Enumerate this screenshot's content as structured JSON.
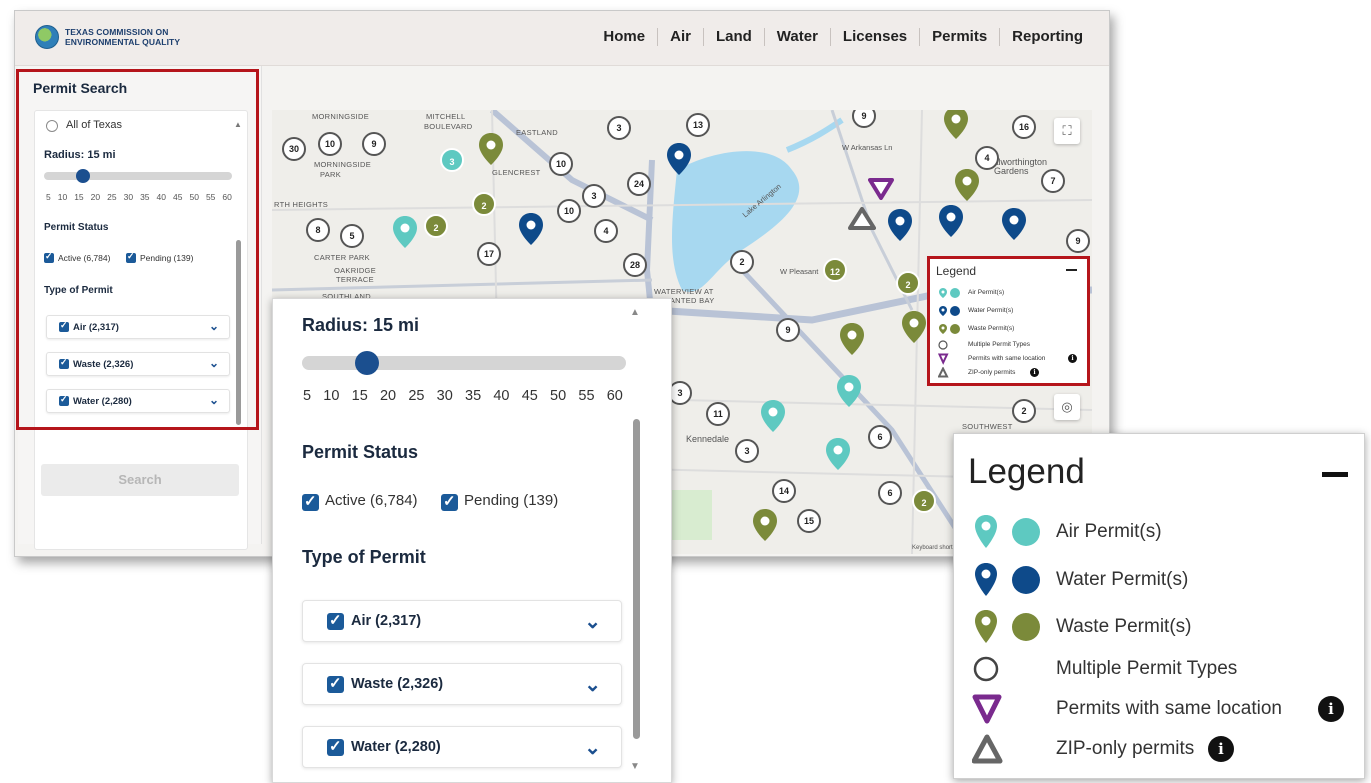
{
  "brand": {
    "line1": "TEXAS COMMISSION ON",
    "line2": "ENVIRONMENTAL QUALITY"
  },
  "nav": [
    "Home",
    "Air",
    "Land",
    "Water",
    "Licenses",
    "Permits",
    "Reporting"
  ],
  "sidebar": {
    "title": "Permit Search",
    "location_option": "All of Texas",
    "radius_label": "Radius: 15 mi",
    "radius_value_mi": 15,
    "radius_ticks": [
      "5",
      "10",
      "15",
      "20",
      "25",
      "30",
      "35",
      "40",
      "45",
      "50",
      "55",
      "60"
    ],
    "status_heading": "Permit Status",
    "status_options": [
      {
        "label": "Active (6,784)",
        "checked": true
      },
      {
        "label": "Pending (139)",
        "checked": true
      }
    ],
    "type_heading": "Type of Permit",
    "types": [
      {
        "label": "Air (2,317)",
        "checked": true
      },
      {
        "label": "Waste (2,326)",
        "checked": true
      },
      {
        "label": "Water (2,280)",
        "checked": true
      }
    ],
    "search_button": "Search"
  },
  "map": {
    "labels": [
      "MORNINGSIDE",
      "MITCHELL",
      "BOULEVARD",
      "EASTLAND",
      "MORNINGSIDE",
      "PARK",
      "GLENCREST",
      "RTH HEIGHTS",
      "CARTER PARK",
      "OAKRIDGE",
      "TERRACE",
      "SOUTHLAND",
      "WATERVIEW AT",
      "GRANTED BAY",
      "Lake Arlington",
      "Kennedale",
      "W Pleasant",
      "Dalworthington",
      "Gardens",
      "SOUTHWEST",
      "W Arkansas Ln",
      "Keyboard shortcuts"
    ],
    "clusters": [
      "30",
      "10",
      "9",
      "3",
      "8",
      "5",
      "17",
      "10",
      "10",
      "3",
      "24",
      "13",
      "4",
      "28",
      "9",
      "16",
      "4",
      "7",
      "9",
      "2",
      "11",
      "3",
      "6",
      "14",
      "15",
      "6",
      "2",
      "9",
      "3"
    ],
    "waste_clusters": [
      "2",
      "2",
      "12",
      "2",
      "2"
    ],
    "air_clusters": [
      "3"
    ]
  },
  "legend": {
    "title": "Legend",
    "items": [
      {
        "label": "Air Permit(s)",
        "color": "#5ec9c1"
      },
      {
        "label": "Water Permit(s)",
        "color": "#0e4a8a"
      },
      {
        "label": "Waste Permit(s)",
        "color": "#7b8a3a"
      },
      {
        "label": "Multiple Permit Types",
        "color": "#ffffff"
      },
      {
        "label": "Permits with same location",
        "color": "#7a2a8e"
      },
      {
        "label": "ZIP-only permits",
        "color": "#666666"
      }
    ]
  },
  "icons": [
    "search-icon",
    "chevron-down-icon",
    "checkbox-checked-icon",
    "fullscreen-icon",
    "locate-icon",
    "info-icon",
    "minimize-icon"
  ]
}
